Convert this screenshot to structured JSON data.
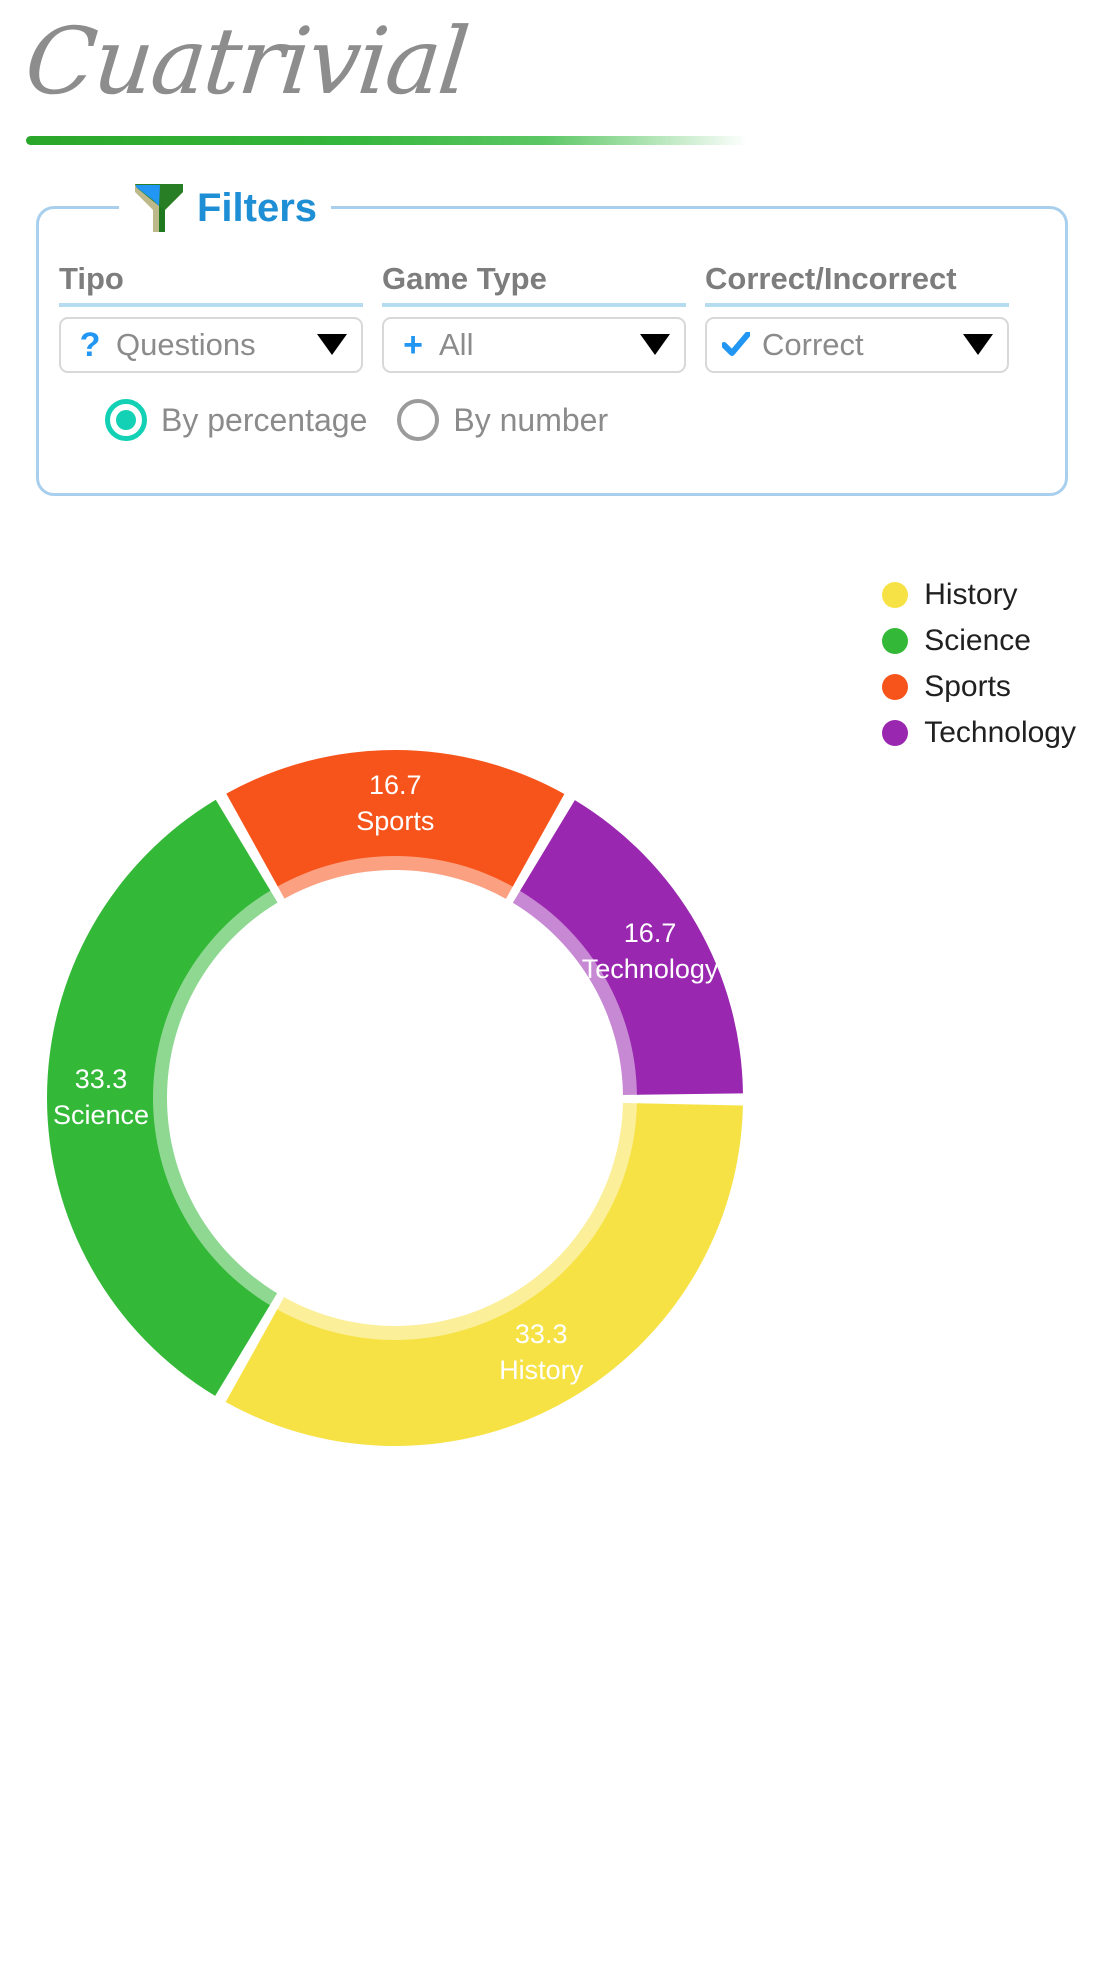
{
  "app": {
    "logo_text": "Cuatrivial"
  },
  "filters": {
    "title": "Filters",
    "icon": "funnel-icon",
    "fields": [
      {
        "label": "Tipo",
        "icon": "question-mark-icon",
        "value": "Questions",
        "caret": "chevron-down-icon"
      },
      {
        "label": "Game Type",
        "icon": "plus-icon",
        "value": "All",
        "caret": "chevron-down-icon"
      },
      {
        "label": "Correct/Incorrect",
        "icon": "check-icon",
        "value": "Correct",
        "caret": "chevron-down-icon"
      }
    ],
    "display_mode": {
      "options": [
        {
          "label": "By percentage",
          "selected": true
        },
        {
          "label": "By number",
          "selected": false
        }
      ]
    }
  },
  "colors": {
    "brand_green": "#2aa72a",
    "accent_blue": "#1e8fd5",
    "radio_teal": "#12d1b4",
    "border_blue": "#a8d0ee",
    "label_gray": "#7d7d7d"
  },
  "chart_data": {
    "type": "pie",
    "variant": "donut",
    "title": "",
    "unit": "percent",
    "value_labels_shown": true,
    "legend_position": "top-right",
    "categories": [
      "History",
      "Science",
      "Sports",
      "Technology"
    ],
    "values": [
      33.3,
      33.3,
      16.7,
      16.7
    ],
    "value_label_text": [
      "33.3",
      "33.3",
      "16.7",
      "16.7"
    ],
    "colors": [
      "#F7E245",
      "#33B838",
      "#F7541C",
      "#9A27B0"
    ],
    "slices": [
      {
        "name": "History",
        "value": 33.3,
        "label": "33.3",
        "color": "#F7E245"
      },
      {
        "name": "Science",
        "value": 33.3,
        "label": "33.3",
        "color": "#33B838"
      },
      {
        "name": "Sports",
        "value": 16.7,
        "label": "16.7",
        "color": "#F7541C"
      },
      {
        "name": "Technology",
        "value": 16.7,
        "label": "16.7",
        "color": "#9A27B0"
      }
    ],
    "legend": [
      {
        "label": "History",
        "color": "#F7E245"
      },
      {
        "label": "Science",
        "color": "#33B838"
      },
      {
        "label": "Sports",
        "color": "#F7541C"
      },
      {
        "label": "Technology",
        "color": "#9A27B0"
      }
    ]
  }
}
